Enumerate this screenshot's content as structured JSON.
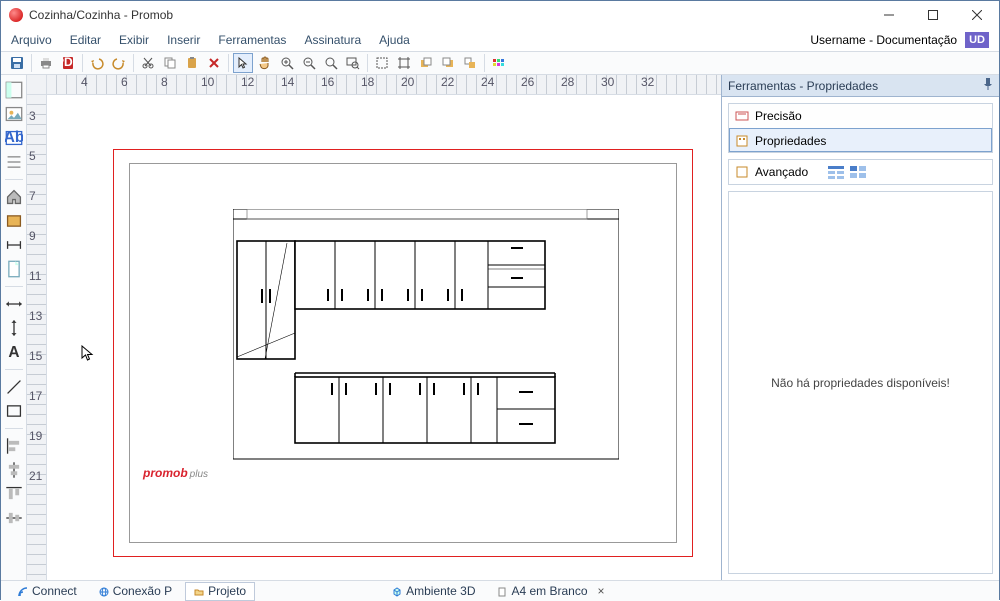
{
  "window": {
    "title": "Cozinha/Cozinha - Promob"
  },
  "user": {
    "label": "Username - Documentação",
    "badge": "UD"
  },
  "menu": {
    "arquivo": "Arquivo",
    "editar": "Editar",
    "exibir": "Exibir",
    "inserir": "Inserir",
    "ferramentas": "Ferramentas",
    "assinatura": "Assinatura",
    "ajuda": "Ajuda"
  },
  "hruler": {
    "t4": "4",
    "t6": "6",
    "t8": "8",
    "t10": "10",
    "t12": "12",
    "t14": "14",
    "t16": "16",
    "t18": "18",
    "t20": "20",
    "t22": "22",
    "t24": "24",
    "t26": "26",
    "t28": "28",
    "t30": "30",
    "t32": "32"
  },
  "vruler": {
    "t3": "3",
    "t5": "5",
    "t7": "7",
    "t9": "9",
    "t11": "11",
    "t13": "13",
    "t15": "15",
    "t17": "17",
    "t19": "19",
    "t21": "21"
  },
  "watermark": {
    "brand": "promob",
    "suffix": "plus"
  },
  "side_panel": {
    "header": "Ferramentas - Propriedades",
    "precision": "Precisão",
    "properties": "Propriedades",
    "advanced": "Avançado",
    "empty": "Não há propriedades disponíveis!"
  },
  "bottom_tabs": {
    "connect": "Connect",
    "conexao": "Conexão P",
    "projeto": "Projeto",
    "ambiente3d": "Ambiente 3D",
    "a4branco": "A4 em Branco"
  }
}
